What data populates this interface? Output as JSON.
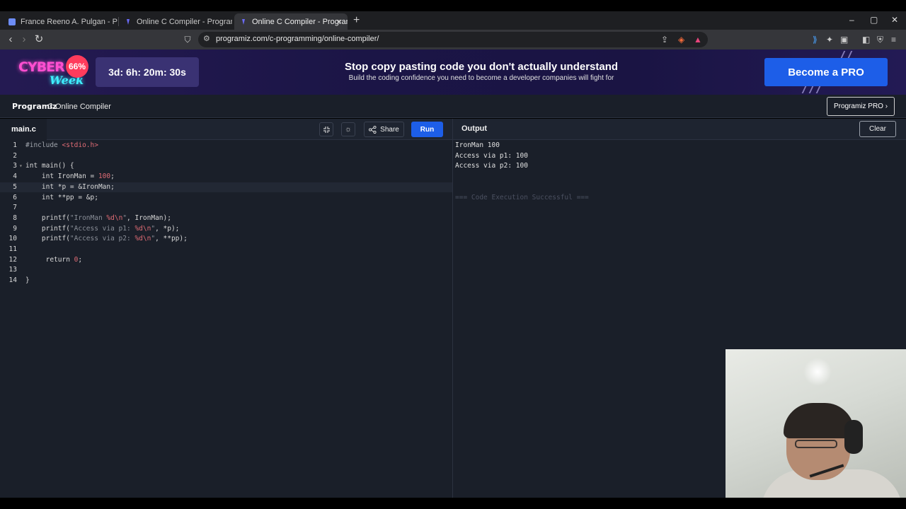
{
  "browser": {
    "tabs": [
      {
        "title": "France Reeno A. Pulgan - Presentatio",
        "active": false
      },
      {
        "title": "Online C Compiler - Programiz",
        "active": false
      },
      {
        "title": "Online C Compiler - Programiz",
        "active": true
      }
    ],
    "url": "programiz.com/c-programming/online-compiler/"
  },
  "banner": {
    "cyber": "CYBER",
    "week": "Week",
    "discount": "66%",
    "countdown": "3d: 6h: 20m: 30s",
    "headline": "Stop copy pasting code you don't actually understand",
    "subline": "Build the coding confidence you need to become a developer companies will fight for",
    "cta": "Become a PRO"
  },
  "header": {
    "logo": "Programiz",
    "title": "C Online Compiler",
    "pro_button": "Programiz PRO ›"
  },
  "editor": {
    "filename": "main.c",
    "share_label": "Share",
    "run_label": "Run",
    "current_line": 5,
    "lines": [
      "#include <stdio.h>",
      "",
      "int main() {",
      "    int IronMan = 100;",
      "    int *p = &IronMan;",
      "    int **pp = &p;",
      "",
      "    printf(\"IronMan %d\\n\", IronMan);",
      "    printf(\"Access via p1: %d\\n\", *p);",
      "    printf(\"Access via p2: %d\\n\", **pp);",
      "",
      "     return 0;",
      "",
      "}"
    ]
  },
  "output": {
    "title": "Output",
    "clear_label": "Clear",
    "lines": [
      "IronMan 100",
      "Access via p1: 100",
      "Access via p2: 100"
    ],
    "status": "=== Code Execution Successful ==="
  }
}
